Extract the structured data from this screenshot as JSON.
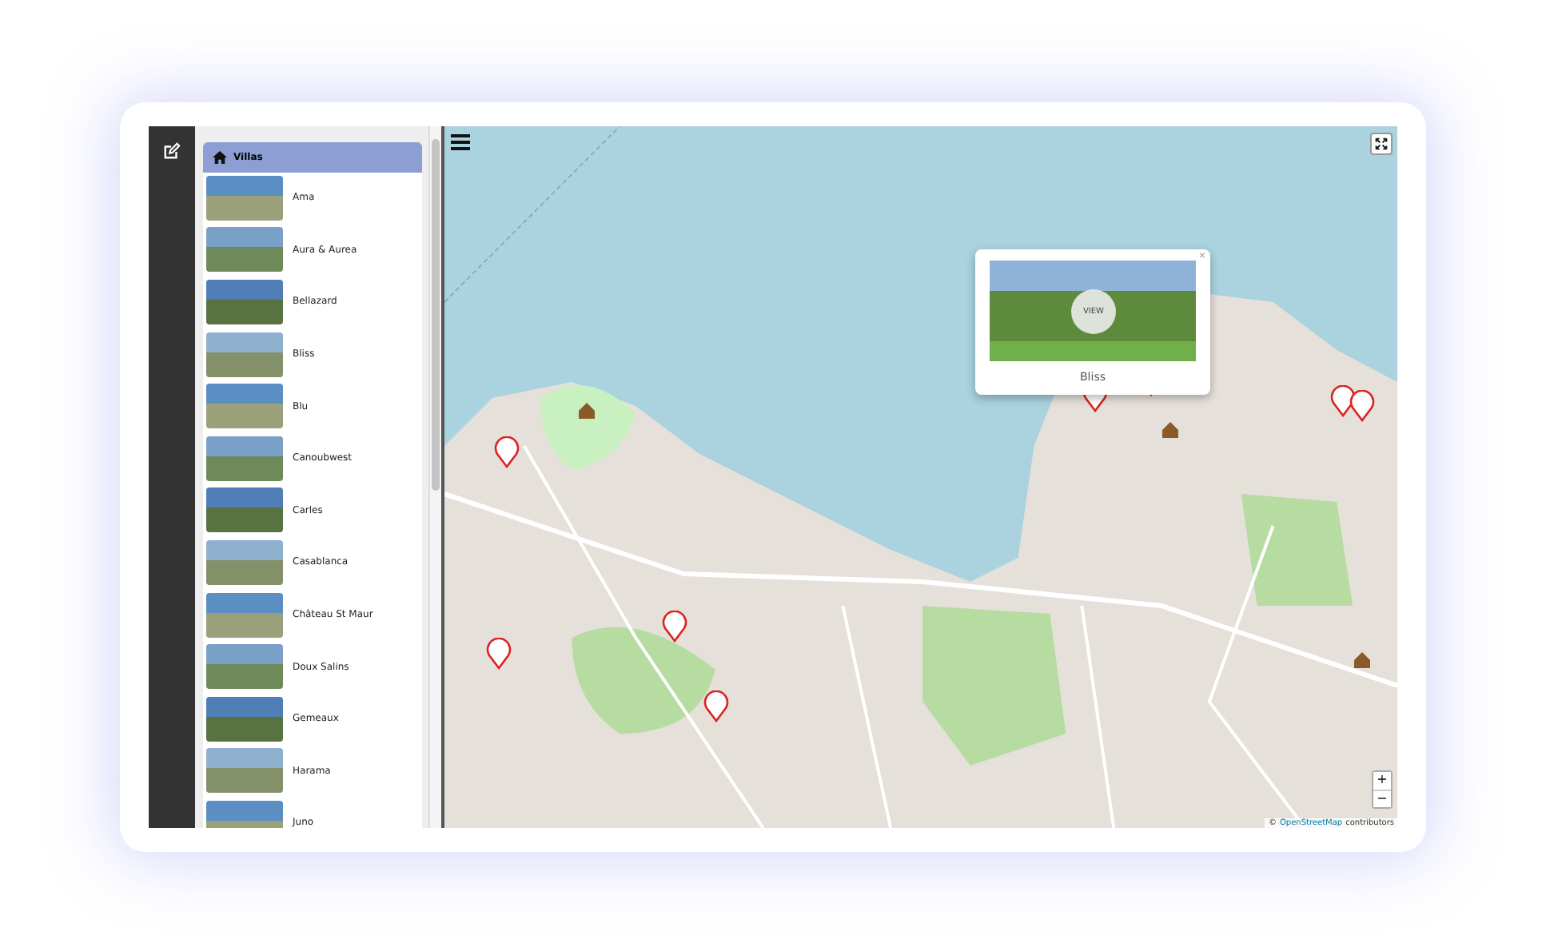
{
  "list": {
    "header": "Villas",
    "items": [
      {
        "name": "Ama",
        "selected": false
      },
      {
        "name": "Aura & Aurea",
        "selected": false
      },
      {
        "name": "Bellazard",
        "selected": false
      },
      {
        "name": "Bliss",
        "selected": false
      },
      {
        "name": "Blu",
        "selected": false
      },
      {
        "name": "Canoubwest",
        "selected": false
      },
      {
        "name": "Carles",
        "selected": false
      },
      {
        "name": "Casablanca",
        "selected": false
      },
      {
        "name": "Château St Maur",
        "selected": false
      },
      {
        "name": "Doux Salins",
        "selected": false
      },
      {
        "name": "Gemeaux",
        "selected": false
      },
      {
        "name": "Harama",
        "selected": false
      },
      {
        "name": "Juno",
        "selected": false
      }
    ]
  },
  "popup": {
    "close": "×",
    "button": "VIEW",
    "title": "Bliss"
  },
  "zoom": {
    "in": "+",
    "out": "−"
  },
  "attribution": {
    "prefix": "©",
    "link": "OpenStreetMap",
    "suffix": "contributors"
  }
}
